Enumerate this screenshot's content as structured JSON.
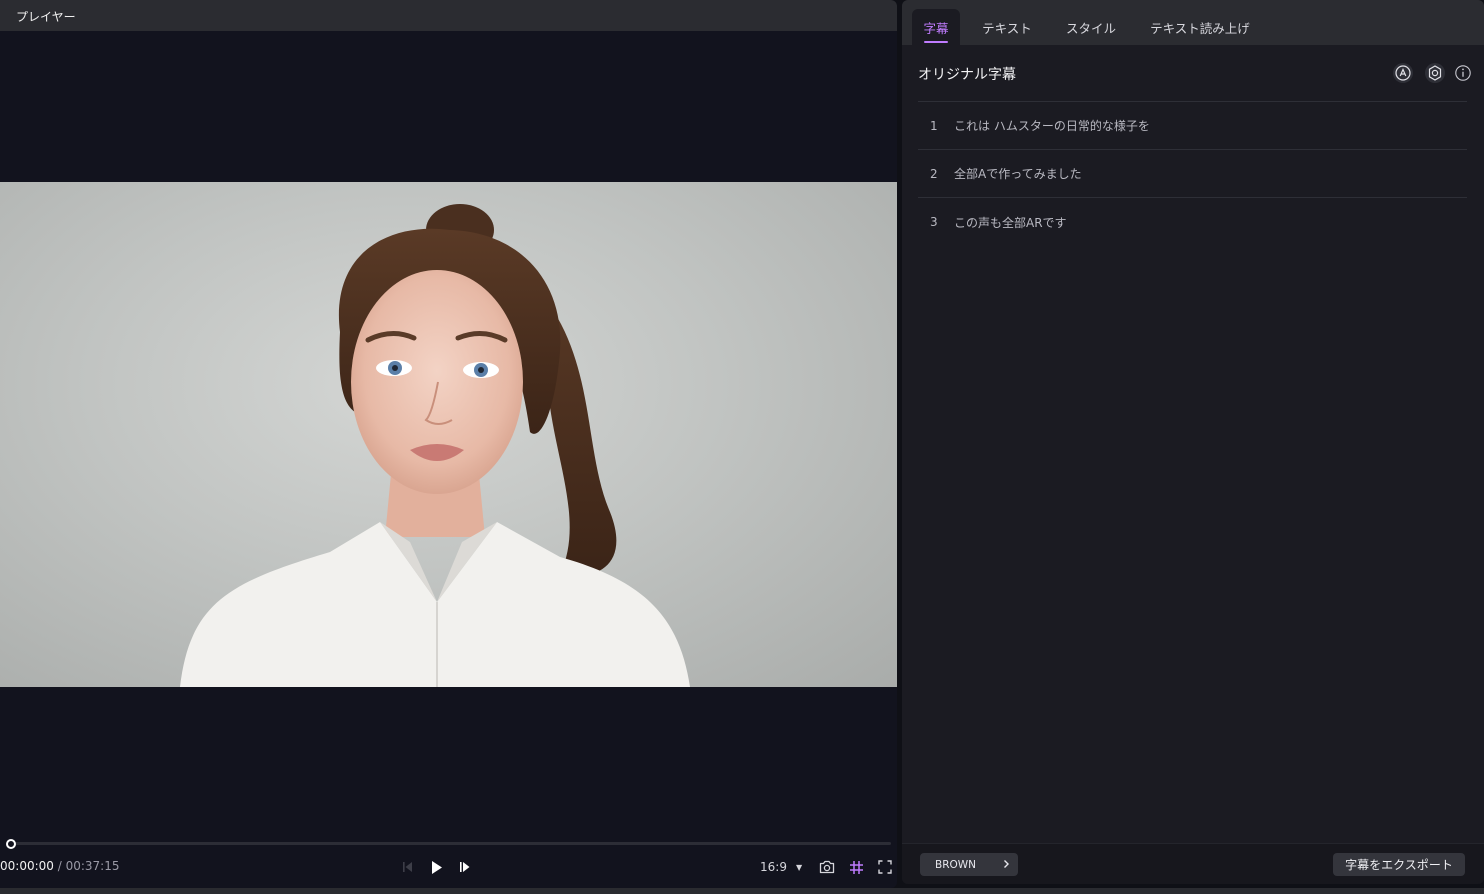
{
  "player": {
    "title": "プレイヤー",
    "time_current": "00:00:00",
    "time_separator": " / ",
    "time_total": "00:37:15",
    "progress": 0.0,
    "aspect_ratio": "16:9",
    "icons": {
      "prev": "previous-frame-icon",
      "play": "play-icon",
      "next": "next-frame-icon",
      "ratio": "chevron-down-icon",
      "snapshot": "camera-icon",
      "grid": "grid-icon",
      "fullscreen": "fullscreen-icon"
    },
    "grid_active_color": "#c07cff"
  },
  "panel": {
    "tabs": [
      {
        "label": "字幕",
        "active": true
      },
      {
        "label": "テキスト",
        "active": false
      },
      {
        "label": "スタイル",
        "active": false
      },
      {
        "label": "テキスト読み上げ",
        "active": false
      }
    ],
    "section_title": "オリジナル字幕",
    "header_icons": [
      "translate-icon",
      "settings-icon",
      "info-icon"
    ],
    "subtitles": [
      {
        "index": "1",
        "text": "これは ハムスターの日常的な様子を"
      },
      {
        "index": "2",
        "text": "全部Aで作ってみました"
      },
      {
        "index": "3",
        "text": "この声も全部ARです"
      }
    ],
    "voice_label": "BROWN",
    "export_label": "字幕をエクスポート",
    "accent_color": "#c07cff"
  }
}
